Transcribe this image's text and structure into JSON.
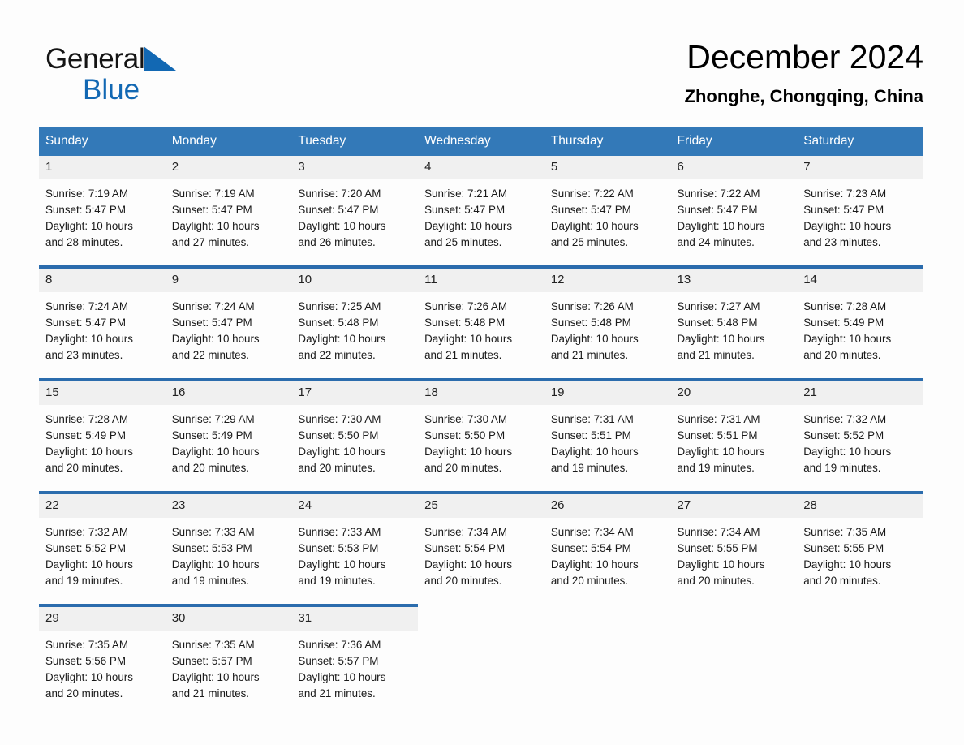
{
  "brand": {
    "word1": "General",
    "word2": "Blue",
    "triangle_color": "#1268b3"
  },
  "header": {
    "title": "December 2024",
    "subtitle": "Zhonghe, Chongqing, China"
  },
  "theme": {
    "header_blue": "#3379b8",
    "divider_blue": "#2b6cad",
    "daynum_background": "#f0f0f0",
    "page_background": "#fdfdfd"
  },
  "weekday_headers": [
    "Sunday",
    "Monday",
    "Tuesday",
    "Wednesday",
    "Thursday",
    "Friday",
    "Saturday"
  ],
  "labels": {
    "sunrise_prefix": "Sunrise:",
    "sunset_prefix": "Sunset:",
    "daylight_prefix": "Daylight:"
  },
  "weeks": [
    [
      {
        "day": "1",
        "sunrise": "Sunrise: 7:19 AM",
        "sunset": "Sunset: 5:47 PM",
        "daylight1": "Daylight: 10 hours",
        "daylight2": "and 28 minutes."
      },
      {
        "day": "2",
        "sunrise": "Sunrise: 7:19 AM",
        "sunset": "Sunset: 5:47 PM",
        "daylight1": "Daylight: 10 hours",
        "daylight2": "and 27 minutes."
      },
      {
        "day": "3",
        "sunrise": "Sunrise: 7:20 AM",
        "sunset": "Sunset: 5:47 PM",
        "daylight1": "Daylight: 10 hours",
        "daylight2": "and 26 minutes."
      },
      {
        "day": "4",
        "sunrise": "Sunrise: 7:21 AM",
        "sunset": "Sunset: 5:47 PM",
        "daylight1": "Daylight: 10 hours",
        "daylight2": "and 25 minutes."
      },
      {
        "day": "5",
        "sunrise": "Sunrise: 7:22 AM",
        "sunset": "Sunset: 5:47 PM",
        "daylight1": "Daylight: 10 hours",
        "daylight2": "and 25 minutes."
      },
      {
        "day": "6",
        "sunrise": "Sunrise: 7:22 AM",
        "sunset": "Sunset: 5:47 PM",
        "daylight1": "Daylight: 10 hours",
        "daylight2": "and 24 minutes."
      },
      {
        "day": "7",
        "sunrise": "Sunrise: 7:23 AM",
        "sunset": "Sunset: 5:47 PM",
        "daylight1": "Daylight: 10 hours",
        "daylight2": "and 23 minutes."
      }
    ],
    [
      {
        "day": "8",
        "sunrise": "Sunrise: 7:24 AM",
        "sunset": "Sunset: 5:47 PM",
        "daylight1": "Daylight: 10 hours",
        "daylight2": "and 23 minutes."
      },
      {
        "day": "9",
        "sunrise": "Sunrise: 7:24 AM",
        "sunset": "Sunset: 5:47 PM",
        "daylight1": "Daylight: 10 hours",
        "daylight2": "and 22 minutes."
      },
      {
        "day": "10",
        "sunrise": "Sunrise: 7:25 AM",
        "sunset": "Sunset: 5:48 PM",
        "daylight1": "Daylight: 10 hours",
        "daylight2": "and 22 minutes."
      },
      {
        "day": "11",
        "sunrise": "Sunrise: 7:26 AM",
        "sunset": "Sunset: 5:48 PM",
        "daylight1": "Daylight: 10 hours",
        "daylight2": "and 21 minutes."
      },
      {
        "day": "12",
        "sunrise": "Sunrise: 7:26 AM",
        "sunset": "Sunset: 5:48 PM",
        "daylight1": "Daylight: 10 hours",
        "daylight2": "and 21 minutes."
      },
      {
        "day": "13",
        "sunrise": "Sunrise: 7:27 AM",
        "sunset": "Sunset: 5:48 PM",
        "daylight1": "Daylight: 10 hours",
        "daylight2": "and 21 minutes."
      },
      {
        "day": "14",
        "sunrise": "Sunrise: 7:28 AM",
        "sunset": "Sunset: 5:49 PM",
        "daylight1": "Daylight: 10 hours",
        "daylight2": "and 20 minutes."
      }
    ],
    [
      {
        "day": "15",
        "sunrise": "Sunrise: 7:28 AM",
        "sunset": "Sunset: 5:49 PM",
        "daylight1": "Daylight: 10 hours",
        "daylight2": "and 20 minutes."
      },
      {
        "day": "16",
        "sunrise": "Sunrise: 7:29 AM",
        "sunset": "Sunset: 5:49 PM",
        "daylight1": "Daylight: 10 hours",
        "daylight2": "and 20 minutes."
      },
      {
        "day": "17",
        "sunrise": "Sunrise: 7:30 AM",
        "sunset": "Sunset: 5:50 PM",
        "daylight1": "Daylight: 10 hours",
        "daylight2": "and 20 minutes."
      },
      {
        "day": "18",
        "sunrise": "Sunrise: 7:30 AM",
        "sunset": "Sunset: 5:50 PM",
        "daylight1": "Daylight: 10 hours",
        "daylight2": "and 20 minutes."
      },
      {
        "day": "19",
        "sunrise": "Sunrise: 7:31 AM",
        "sunset": "Sunset: 5:51 PM",
        "daylight1": "Daylight: 10 hours",
        "daylight2": "and 19 minutes."
      },
      {
        "day": "20",
        "sunrise": "Sunrise: 7:31 AM",
        "sunset": "Sunset: 5:51 PM",
        "daylight1": "Daylight: 10 hours",
        "daylight2": "and 19 minutes."
      },
      {
        "day": "21",
        "sunrise": "Sunrise: 7:32 AM",
        "sunset": "Sunset: 5:52 PM",
        "daylight1": "Daylight: 10 hours",
        "daylight2": "and 19 minutes."
      }
    ],
    [
      {
        "day": "22",
        "sunrise": "Sunrise: 7:32 AM",
        "sunset": "Sunset: 5:52 PM",
        "daylight1": "Daylight: 10 hours",
        "daylight2": "and 19 minutes."
      },
      {
        "day": "23",
        "sunrise": "Sunrise: 7:33 AM",
        "sunset": "Sunset: 5:53 PM",
        "daylight1": "Daylight: 10 hours",
        "daylight2": "and 19 minutes."
      },
      {
        "day": "24",
        "sunrise": "Sunrise: 7:33 AM",
        "sunset": "Sunset: 5:53 PM",
        "daylight1": "Daylight: 10 hours",
        "daylight2": "and 19 minutes."
      },
      {
        "day": "25",
        "sunrise": "Sunrise: 7:34 AM",
        "sunset": "Sunset: 5:54 PM",
        "daylight1": "Daylight: 10 hours",
        "daylight2": "and 20 minutes."
      },
      {
        "day": "26",
        "sunrise": "Sunrise: 7:34 AM",
        "sunset": "Sunset: 5:54 PM",
        "daylight1": "Daylight: 10 hours",
        "daylight2": "and 20 minutes."
      },
      {
        "day": "27",
        "sunrise": "Sunrise: 7:34 AM",
        "sunset": "Sunset: 5:55 PM",
        "daylight1": "Daylight: 10 hours",
        "daylight2": "and 20 minutes."
      },
      {
        "day": "28",
        "sunrise": "Sunrise: 7:35 AM",
        "sunset": "Sunset: 5:55 PM",
        "daylight1": "Daylight: 10 hours",
        "daylight2": "and 20 minutes."
      }
    ],
    [
      {
        "day": "29",
        "sunrise": "Sunrise: 7:35 AM",
        "sunset": "Sunset: 5:56 PM",
        "daylight1": "Daylight: 10 hours",
        "daylight2": "and 20 minutes."
      },
      {
        "day": "30",
        "sunrise": "Sunrise: 7:35 AM",
        "sunset": "Sunset: 5:57 PM",
        "daylight1": "Daylight: 10 hours",
        "daylight2": "and 21 minutes."
      },
      {
        "day": "31",
        "sunrise": "Sunrise: 7:36 AM",
        "sunset": "Sunset: 5:57 PM",
        "daylight1": "Daylight: 10 hours",
        "daylight2": "and 21 minutes."
      },
      {
        "day": "",
        "sunrise": "",
        "sunset": "",
        "daylight1": "",
        "daylight2": ""
      },
      {
        "day": "",
        "sunrise": "",
        "sunset": "",
        "daylight1": "",
        "daylight2": ""
      },
      {
        "day": "",
        "sunrise": "",
        "sunset": "",
        "daylight1": "",
        "daylight2": ""
      },
      {
        "day": "",
        "sunrise": "",
        "sunset": "",
        "daylight1": "",
        "daylight2": ""
      }
    ]
  ]
}
